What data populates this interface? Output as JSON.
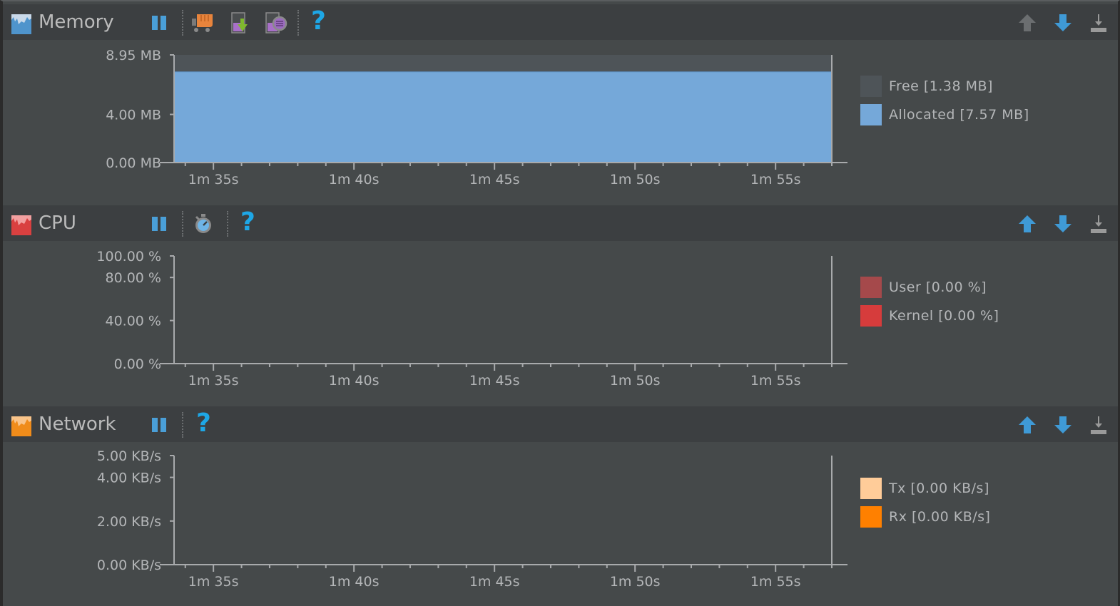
{
  "panels": [
    {
      "id": "memory",
      "title": "Memory",
      "icon": "memory-monitor-icon",
      "icon_color": "#5a9fd4",
      "toolbar": {
        "pause_label": "Pause",
        "gc_label": "Initiate GC",
        "dump_java_heap_label": "Dump Java Heap",
        "allocation_tracker_label": "Start Allocation Tracking",
        "help_label": "?",
        "scroll_up_enabled": false
      },
      "legend": [
        {
          "label": "Free [1.38 MB]",
          "color": "#4e5458"
        },
        {
          "label": "Allocated [7.57 MB]",
          "color": "#75a8d9"
        }
      ]
    },
    {
      "id": "cpu",
      "title": "CPU",
      "icon": "cpu-monitor-icon",
      "icon_color": "#d94040",
      "toolbar": {
        "pause_label": "Pause",
        "method_trace_label": "Start Method Tracing",
        "help_label": "?",
        "scroll_up_enabled": true
      },
      "legend": [
        {
          "label": "User [0.00 %]",
          "color": "#a5494b"
        },
        {
          "label": "Kernel [0.00 %]",
          "color": "#d63c3c"
        }
      ]
    },
    {
      "id": "network",
      "title": "Network",
      "icon": "network-monitor-icon",
      "icon_color": "#f08c1a",
      "toolbar": {
        "pause_label": "Pause",
        "help_label": "?",
        "scroll_up_enabled": true
      },
      "legend": [
        {
          "label": "Tx [0.00 KB/s]",
          "color": "#ffcc99"
        },
        {
          "label": "Rx [0.00 KB/s]",
          "color": "#ff8000"
        }
      ]
    }
  ],
  "chart_data": [
    {
      "type": "area",
      "title": "Memory",
      "xlabel": "",
      "ylabel": "",
      "x_range_seconds": [
        93.6,
        117.0
      ],
      "x_ticks": [
        "1m 35s",
        "1m 40s",
        "1m 45s",
        "1m 50s",
        "1m 55s"
      ],
      "x_tick_values": [
        95,
        100,
        105,
        110,
        115
      ],
      "y_ticks": [
        "0.00 MB",
        "4.00 MB",
        "8.95 MB"
      ],
      "y_tick_values": [
        0,
        4.0,
        8.95
      ],
      "ylim": [
        0,
        8.95
      ],
      "stacked": true,
      "series": [
        {
          "name": "Allocated",
          "color": "#75a8d9",
          "x": [
            93.6,
            117.0
          ],
          "values": [
            7.57,
            7.57
          ]
        },
        {
          "name": "Free",
          "color": "#4e5458",
          "x": [
            93.6,
            117.0
          ],
          "values": [
            1.38,
            1.38
          ]
        }
      ],
      "legend": "right"
    },
    {
      "type": "area",
      "title": "CPU",
      "xlabel": "",
      "ylabel": "",
      "x_range_seconds": [
        93.6,
        117.0
      ],
      "x_ticks": [
        "1m 35s",
        "1m 40s",
        "1m 45s",
        "1m 50s",
        "1m 55s"
      ],
      "x_tick_values": [
        95,
        100,
        105,
        110,
        115
      ],
      "y_ticks": [
        "0.00 %",
        "40.00 %",
        "80.00 %",
        "100.00 %"
      ],
      "y_tick_values": [
        0,
        40,
        80,
        100
      ],
      "ylim": [
        0,
        100
      ],
      "series": [
        {
          "name": "User",
          "color": "#a5494b",
          "x": [
            93.6,
            117.0
          ],
          "values": [
            0,
            0
          ]
        },
        {
          "name": "Kernel",
          "color": "#d63c3c",
          "x": [
            93.6,
            117.0
          ],
          "values": [
            0,
            0
          ]
        }
      ],
      "legend": "right"
    },
    {
      "type": "area",
      "title": "Network",
      "xlabel": "",
      "ylabel": "",
      "x_range_seconds": [
        93.6,
        117.0
      ],
      "x_ticks": [
        "1m 35s",
        "1m 40s",
        "1m 45s",
        "1m 50s",
        "1m 55s"
      ],
      "x_tick_values": [
        95,
        100,
        105,
        110,
        115
      ],
      "y_ticks": [
        "0.00 KB/s",
        "2.00 KB/s",
        "4.00 KB/s",
        "5.00 KB/s"
      ],
      "y_tick_values": [
        0,
        2,
        4,
        5
      ],
      "ylim": [
        0,
        5
      ],
      "series": [
        {
          "name": "Tx",
          "color": "#ffcc99",
          "x": [
            93.6,
            117.0
          ],
          "values": [
            0,
            0
          ]
        },
        {
          "name": "Rx",
          "color": "#ff8000",
          "x": [
            93.6,
            117.0
          ],
          "values": [
            0,
            0
          ]
        }
      ],
      "legend": "right"
    }
  ]
}
